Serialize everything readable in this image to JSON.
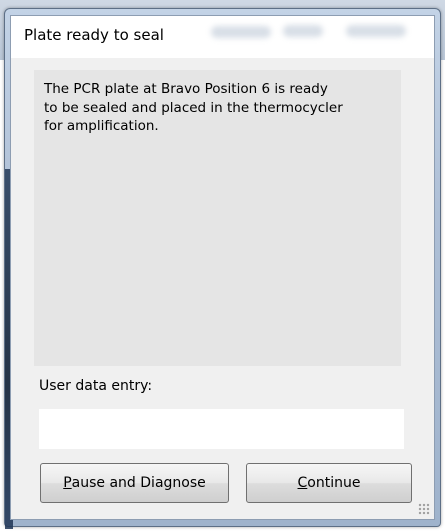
{
  "window": {
    "title": "Plate ready to seal"
  },
  "message": {
    "text": "The PCR plate at Bravo Position 6 is ready\nto be sealed and placed in the thermocycler\nfor amplification."
  },
  "entry": {
    "label": "User data entry:",
    "value": ""
  },
  "buttons": {
    "pause": {
      "accel": "P",
      "rest": "ause and Diagnose"
    },
    "continue": {
      "accel": "C",
      "rest": "ontinue"
    }
  },
  "colors": {
    "dialog_bg": "#f0f0f0",
    "message_bg": "#e5e5e5",
    "frame": "#aebfd6"
  }
}
